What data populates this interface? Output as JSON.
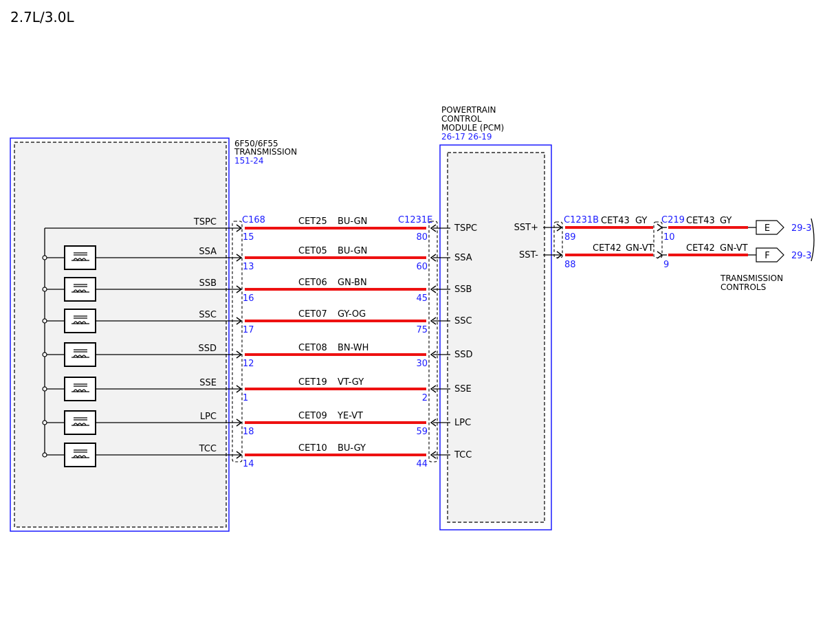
{
  "title": "2.7L/3.0L",
  "transmission": {
    "name_line1": "6F50/6F55",
    "name_line2": "TRANSMISSION",
    "ref": "151-24"
  },
  "pcm": {
    "name_line1": "POWERTRAIN",
    "name_line2": "CONTROL",
    "name_line3": "MODULE (PCM)",
    "ref": "26-17 26-19"
  },
  "connectors": {
    "trans_side": "C168",
    "pcm_side": "C1231E",
    "pcm_out": "C1231B",
    "inline": "C219"
  },
  "circuits": [
    {
      "signal": "TSPC",
      "circuit": "CET25",
      "color": "BU-GN",
      "pin_trans": "15",
      "pin_pcm": "80",
      "solenoid": false
    },
    {
      "signal": "SSA",
      "circuit": "CET05",
      "color": "BU-GN",
      "pin_trans": "13",
      "pin_pcm": "60",
      "solenoid": true
    },
    {
      "signal": "SSB",
      "circuit": "CET06",
      "color": "GN-BN",
      "pin_trans": "16",
      "pin_pcm": "45",
      "solenoid": true
    },
    {
      "signal": "SSC",
      "circuit": "CET07",
      "color": "GY-OG",
      "pin_trans": "17",
      "pin_pcm": "75",
      "solenoid": true
    },
    {
      "signal": "SSD",
      "circuit": "CET08",
      "color": "BN-WH",
      "pin_trans": "12",
      "pin_pcm": "30",
      "solenoid": true
    },
    {
      "signal": "SSE",
      "circuit": "CET19",
      "color": "VT-GY",
      "pin_trans": "1",
      "pin_pcm": "2",
      "solenoid": true
    },
    {
      "signal": "LPC",
      "circuit": "CET09",
      "color": "YE-VT",
      "pin_trans": "18",
      "pin_pcm": "59",
      "solenoid": true
    },
    {
      "signal": "TCC",
      "circuit": "CET10",
      "color": "BU-GY",
      "pin_trans": "14",
      "pin_pcm": "44",
      "solenoid": true
    }
  ],
  "sst_circuits": [
    {
      "signal": "SST+",
      "circuit_a": "CET43",
      "color_a": "GY",
      "pin_pcm": "89",
      "pin_inline": "10",
      "circuit_b": "CET43",
      "color_b": "GY",
      "terminal": "E",
      "ref": "29-3"
    },
    {
      "signal": "SST-",
      "circuit_a": "CET42",
      "color_a": "GN-VT",
      "pin_pcm": "88",
      "pin_inline": "9",
      "circuit_b": "CET42",
      "color_b": "GN-VT",
      "terminal": "F",
      "ref": "29-3"
    }
  ],
  "destination": {
    "line1": "TRANSMISSION",
    "line2": "CONTROLS"
  },
  "colors": {
    "wire": "#ee1111",
    "reference": "#1a1aff"
  }
}
